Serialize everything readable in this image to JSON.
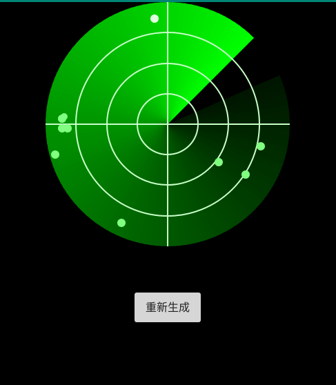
{
  "colors": {
    "background": "#000000",
    "top_bar": "#008577",
    "ring": "#c8ffc8",
    "sweep_core": "#00ff00",
    "blip": "#80ff80",
    "blip_bright": "#e0ffe0",
    "button_bg": "#d6d6d6"
  },
  "radar": {
    "ring_count": 4,
    "sweep_angle_deg": 45,
    "icon": "radar-scope"
  },
  "controls": {
    "regenerate_label": "重新生成"
  }
}
